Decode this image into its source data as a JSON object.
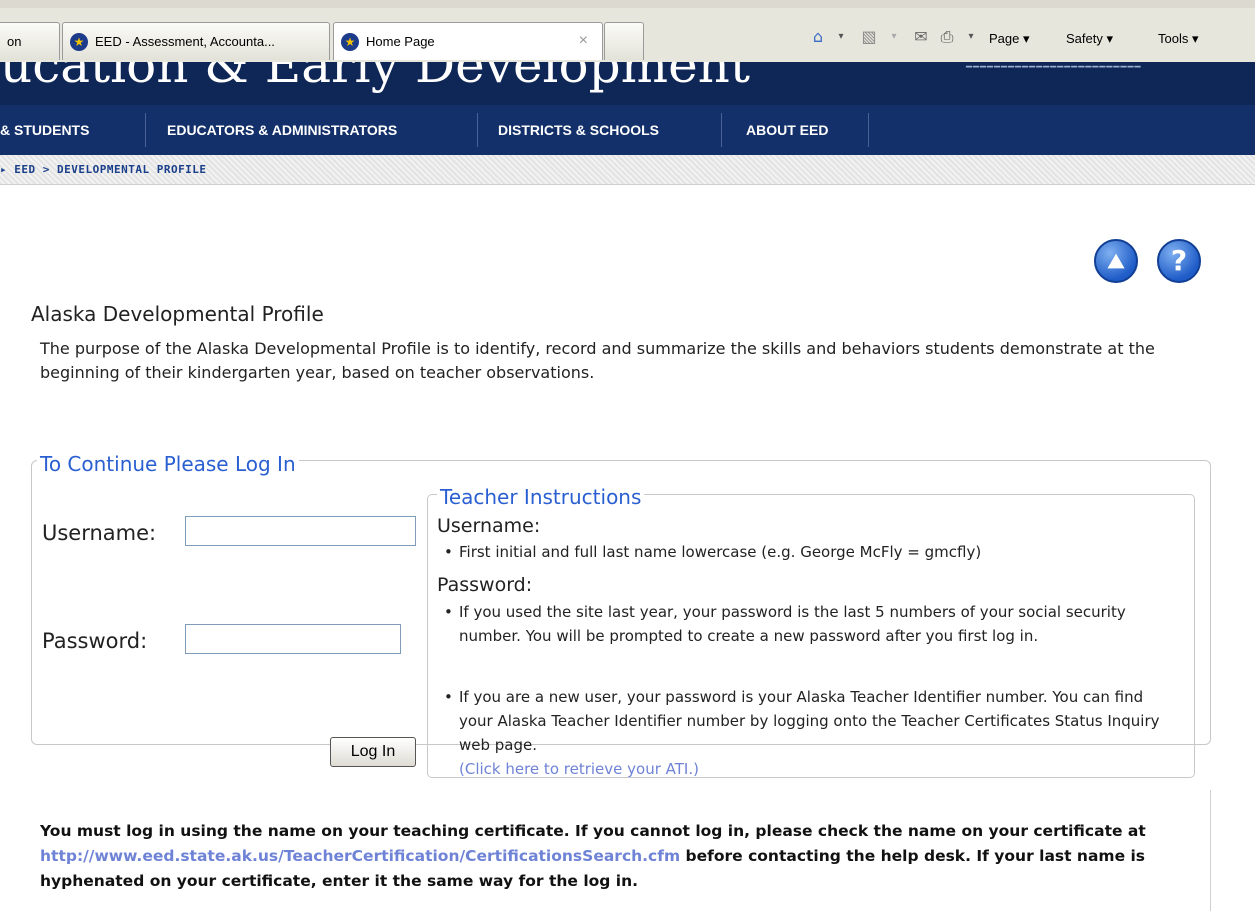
{
  "browser": {
    "tabs": [
      {
        "label": "on"
      },
      {
        "label": "EED - Assessment, Accounta..."
      },
      {
        "label": "Home Page",
        "close": "×"
      }
    ],
    "commands": {
      "page": "Page ▾",
      "safety": "Safety ▾",
      "tools": "Tools ▾"
    },
    "icons": [
      "home-icon",
      "rss-feed-icon",
      "read-mail-icon",
      "print-icon"
    ]
  },
  "site": {
    "title": "ucation & Early Development",
    "nav": [
      "& STUDENTS",
      "EDUCATORS & ADMINISTRATORS",
      "DISTRICTS & SCHOOLS",
      "ABOUT EED"
    ],
    "breadcrumb": "▸ EED  > DEVELOPMENTAL PROFILE"
  },
  "page": {
    "title": "Alaska Developmental Profile",
    "purpose": "The purpose of the Alaska Developmental Profile is to identify, record and summarize the skills and behaviors students demonstrate at the beginning of their kindergarten year, based on teacher observations."
  },
  "login": {
    "legend": "To Continue Please Log In",
    "username_label": "Username:",
    "username_value": "",
    "password_label": "Password:",
    "password_value": "",
    "button": "Log In"
  },
  "instructions": {
    "legend": "Teacher Instructions",
    "username_head": "Username:",
    "username_bullet": "First initial and full last name lowercase (e.g. George McFly = gmcfly)",
    "password_head": "Password:",
    "password_bullet1": "If you used the site last year, your password is the last 5 numbers of your social security number. You will be prompted to create a new password after you first log in.",
    "password_bullet2": "If you are a new user, your password is your Alaska Teacher Identifier number. You can find your Alaska Teacher Identifier number by logging onto the Teacher Certificates Status Inquiry web page.",
    "ati_link": "(Click here to retrieve your ATI.)"
  },
  "notice": {
    "part1": "You must log in using the name on your teaching certificate. If you cannot log in, please check the name on your certificate at ",
    "link": "http://www.eed.state.ak.us/TeacherCertification/CertificationsSearch.cfm",
    "part2": " before contacting the help desk. If your last name is hyphenated on your certificate, enter it the same way for the log in."
  },
  "colors": {
    "header": "#0e2756",
    "nav": "#14306a",
    "legend": "#2a5fd1",
    "link": "#6f83d6"
  }
}
